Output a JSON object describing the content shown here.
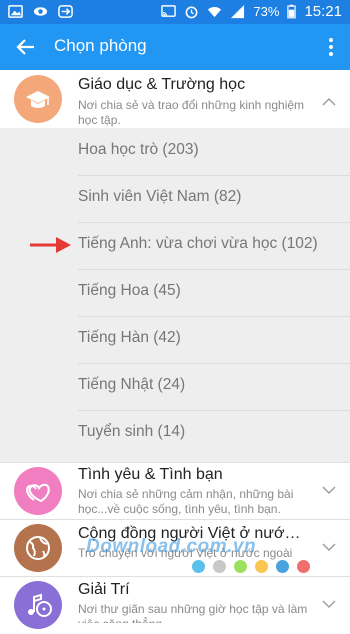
{
  "status_bar": {
    "battery": "73%",
    "time": "15:21",
    "left_icons": [
      "gallery-icon",
      "eye-icon",
      "link-icon"
    ],
    "right_icons": [
      "cast-icon",
      "alarm-icon",
      "wifi-icon",
      "signal-icon",
      "battery-icon"
    ]
  },
  "app_bar": {
    "title": "Chọn phòng",
    "back_icon": "arrow-left-icon",
    "menu_icon": "more-vert-icon"
  },
  "categories": [
    {
      "title": "Giáo dục & Trường học",
      "description": "Nơi chia sẻ và trao đổi những kinh nghiệm học tập.",
      "icon": "graduation-cap-icon",
      "color": "#f4a87a",
      "expanded": true,
      "rooms": [
        {
          "name": "Hoa học trò (203)"
        },
        {
          "name": "Sinh viên Việt Nam (82)"
        },
        {
          "name": "Tiếng Anh: vừa chơi vừa học (102)"
        },
        {
          "name": "Tiếng Hoa (45)"
        },
        {
          "name": "Tiếng Hàn (42)"
        },
        {
          "name": "Tiếng Nhật (24)"
        },
        {
          "name": "Tuyển sinh (14)"
        }
      ]
    },
    {
      "title": "Tình yêu & Tình bạn",
      "description": "Nơi chia sẻ những cảm nhận, những bài học...về cuộc sống, tình yêu, tình bạn.",
      "icon": "hearts-icon",
      "color": "#f07ec1",
      "expanded": false
    },
    {
      "title": "Cộng đồng người Việt ở nước ngoài",
      "description": "Trò chuyện với người Việt ở nước ngoài",
      "icon": "globe-icon",
      "color": "#b5734d",
      "expanded": false
    },
    {
      "title": "Giải Trí",
      "description": "Nơi thư giãn sau những giờ học tập và làm việc căng thẳng",
      "icon": "music-film-icon",
      "color": "#8a6fd6",
      "expanded": false
    }
  ],
  "watermark": {
    "text": "Download.com.vn",
    "dot_colors": [
      "#5bc0eb",
      "#c8c8c8",
      "#9be15d",
      "#f9c74f",
      "#4aa3df",
      "#f26d6d"
    ]
  },
  "annotation": {
    "arrow_color": "#e53935"
  }
}
